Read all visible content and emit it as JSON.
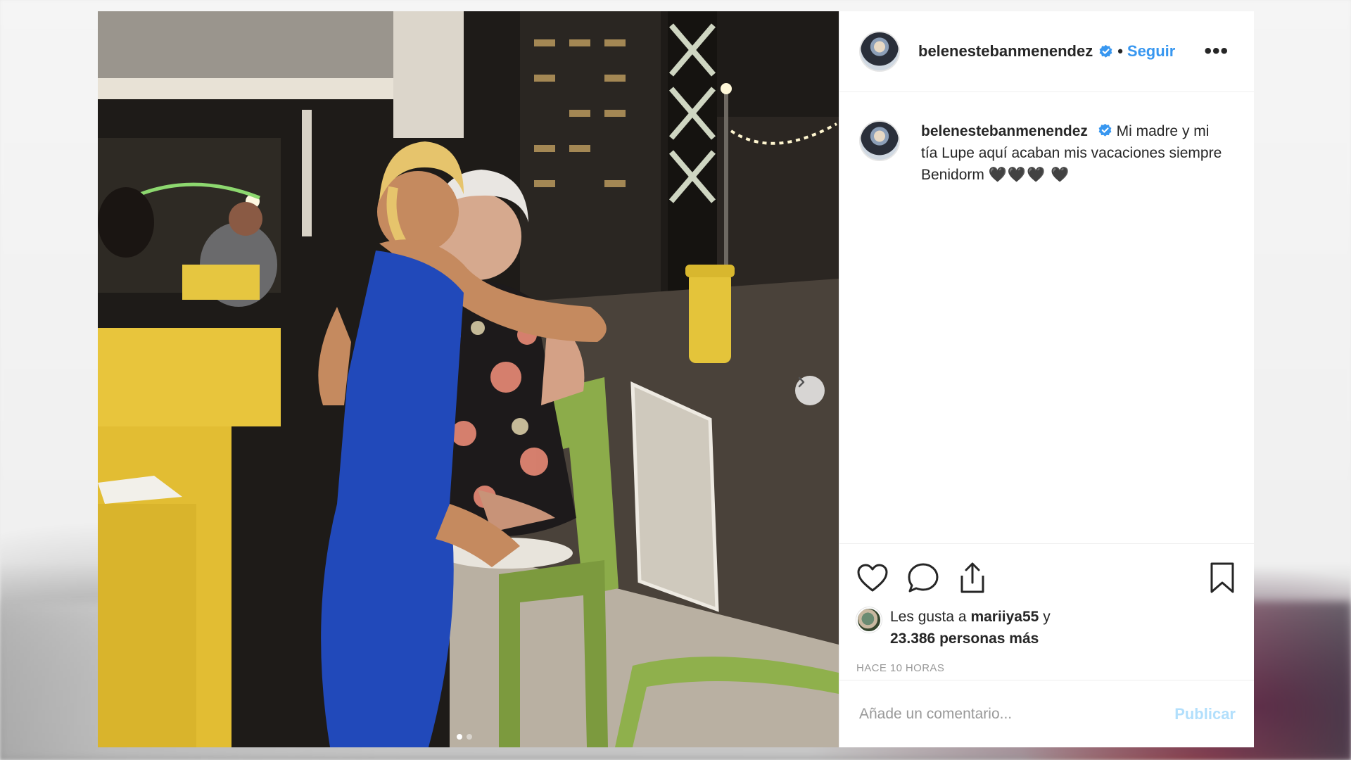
{
  "post": {
    "username": "belenestebanmenendez",
    "verified": true,
    "separator": "•",
    "follow_label": "Seguir",
    "more_label": "•••",
    "caption_text": "Mi madre y mi tía Lupe aquí acaban mis vacaciones siempre Benidorm",
    "caption_hearts": "🖤🖤🖤 🖤",
    "likes": {
      "prefix": "Les gusta a",
      "user": "mariiya55",
      "middle": "y",
      "count_text": "23.386 personas más"
    },
    "timestamp": "HACE 10 HORAS",
    "comment_placeholder": "Añade un comentario...",
    "publish_label": "Publicar"
  },
  "carousel": {
    "current": 1,
    "total": 2
  },
  "icons": {
    "like": "heart-icon",
    "comment": "comment-bubble-icon",
    "share": "share-icon",
    "save": "bookmark-icon",
    "next": "chevron-right-icon",
    "verified": "verified-badge-icon"
  },
  "colors": {
    "link": "#3897f0",
    "publish_disabled": "#b2dffc",
    "text": "#262626",
    "muted": "#999999"
  }
}
